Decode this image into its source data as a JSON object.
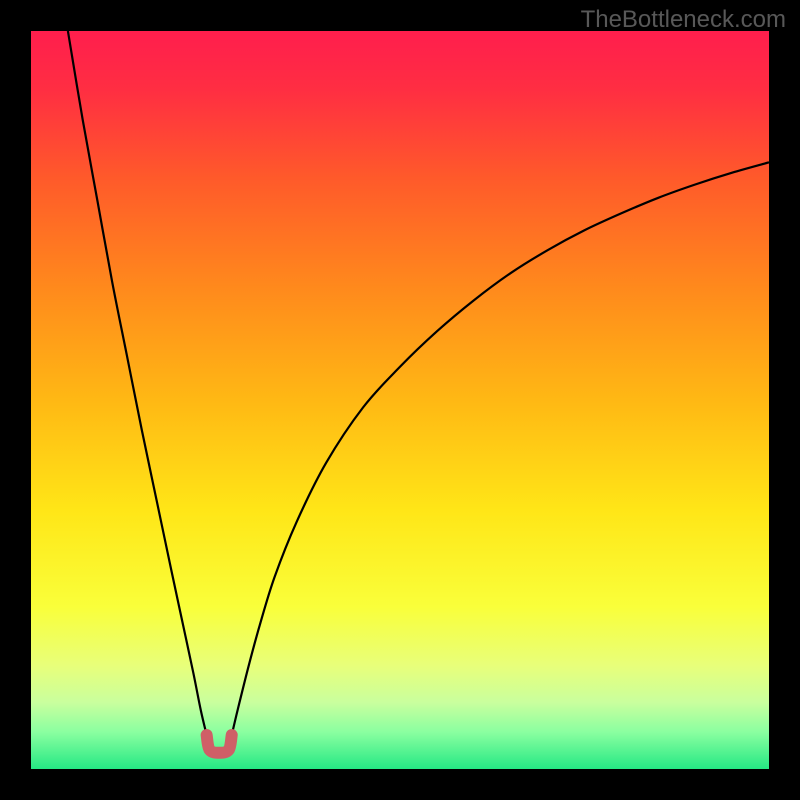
{
  "watermark": "TheBottleneck.com",
  "chart_data": {
    "type": "line",
    "title": "",
    "xlabel": "",
    "ylabel": "",
    "xlim": [
      0,
      100
    ],
    "ylim": [
      0,
      100
    ],
    "grid": false,
    "legend": false,
    "background_gradient_stops": [
      {
        "offset": 0.0,
        "color": "#ff1e4d"
      },
      {
        "offset": 0.08,
        "color": "#ff2e42"
      },
      {
        "offset": 0.2,
        "color": "#ff5a2a"
      },
      {
        "offset": 0.35,
        "color": "#ff8a1c"
      },
      {
        "offset": 0.5,
        "color": "#ffb814"
      },
      {
        "offset": 0.65,
        "color": "#ffe617"
      },
      {
        "offset": 0.78,
        "color": "#f9ff3a"
      },
      {
        "offset": 0.86,
        "color": "#e8ff7a"
      },
      {
        "offset": 0.91,
        "color": "#c9ff9e"
      },
      {
        "offset": 0.95,
        "color": "#8affa0"
      },
      {
        "offset": 1.0,
        "color": "#25e884"
      }
    ],
    "series": [
      {
        "name": "bottleneck-left",
        "color": "#000000",
        "width": 2.2,
        "x": [
          5.0,
          7.0,
          9.0,
          11.0,
          13.0,
          15.0,
          17.0,
          19.0,
          20.5,
          22.0,
          23.0,
          23.8
        ],
        "y": [
          100.0,
          88.0,
          77.0,
          66.0,
          56.0,
          46.0,
          36.5,
          27.0,
          20.0,
          13.0,
          8.0,
          4.6
        ]
      },
      {
        "name": "bottleneck-right",
        "color": "#000000",
        "width": 2.2,
        "x": [
          27.2,
          28.0,
          29.5,
          31.0,
          33.0,
          36.0,
          40.0,
          45.0,
          50.0,
          55.0,
          60.0,
          65.0,
          70.0,
          75.0,
          80.0,
          85.0,
          90.0,
          95.0,
          100.0
        ],
        "y": [
          4.6,
          8.0,
          14.0,
          19.5,
          26.0,
          33.5,
          41.5,
          49.0,
          54.5,
          59.3,
          63.5,
          67.2,
          70.3,
          73.0,
          75.3,
          77.4,
          79.2,
          80.8,
          82.2
        ]
      },
      {
        "name": "optimal-zone-marker",
        "color": "#cf5f67",
        "width": 12,
        "linecap": "round",
        "x": [
          23.8,
          24.2,
          25.5,
          26.8,
          27.2
        ],
        "y": [
          4.6,
          2.6,
          2.2,
          2.6,
          4.6
        ]
      }
    ],
    "optimal_x": 25.5,
    "optimal_y": 2.2
  }
}
